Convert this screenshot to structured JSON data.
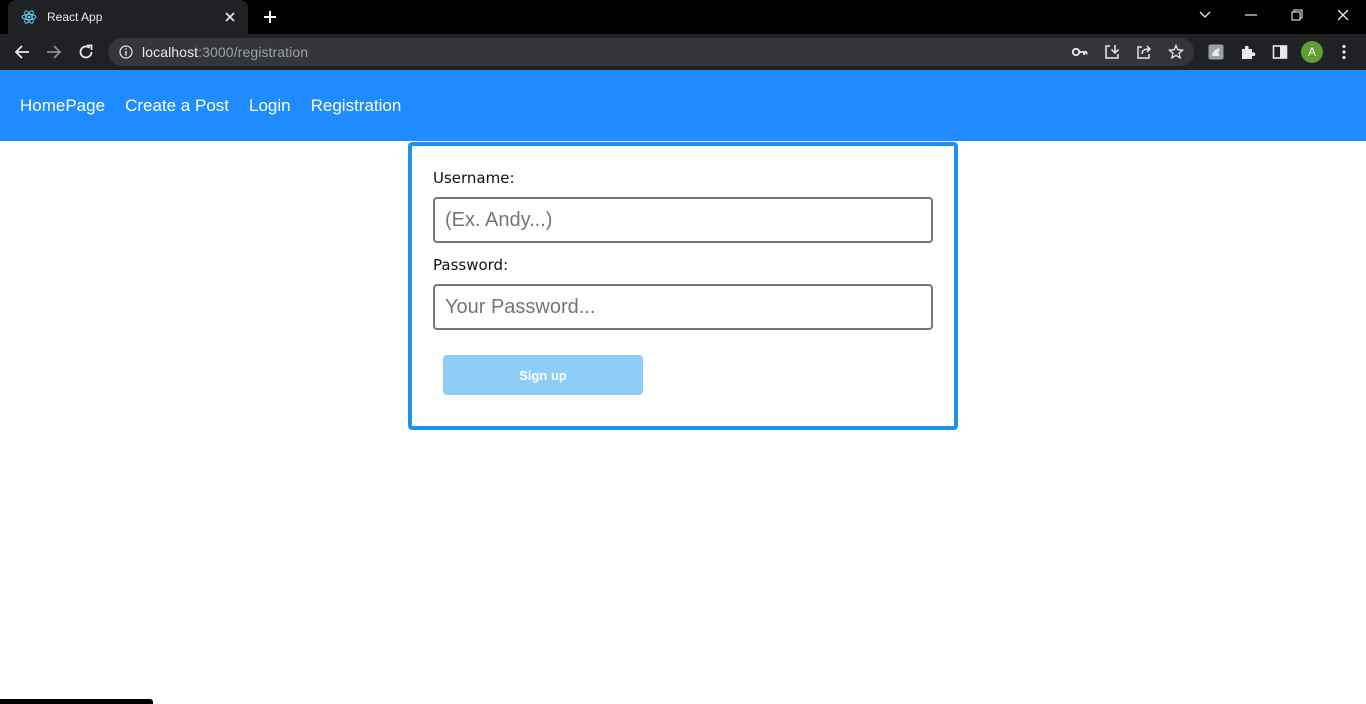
{
  "browser": {
    "tab_title": "React App",
    "url_host": "localhost",
    "url_path": ":3000/registration",
    "profile_initial": "A",
    "icons": [
      "react-icon",
      "close-icon",
      "plus-icon",
      "chevron-down-icon",
      "minimize-icon",
      "restore-icon",
      "back-icon",
      "forward-icon",
      "reload-icon",
      "info-icon",
      "key-icon",
      "install-icon",
      "share-icon",
      "star-icon",
      "extension-icon",
      "puzzle-icon",
      "side-panel-icon",
      "menu-icon"
    ]
  },
  "nav": {
    "links": [
      "HomePage",
      "Create a Post",
      "Login",
      "Registration"
    ]
  },
  "form": {
    "username_label": "Username:",
    "username_placeholder": "(Ex. Andy...)",
    "password_label": "Password:",
    "password_placeholder": "Your Password...",
    "submit_label": "Sign up"
  },
  "colors": {
    "navbar": "#1e8cff",
    "card_border": "#1f93ea",
    "button": "#8ecdf8"
  }
}
